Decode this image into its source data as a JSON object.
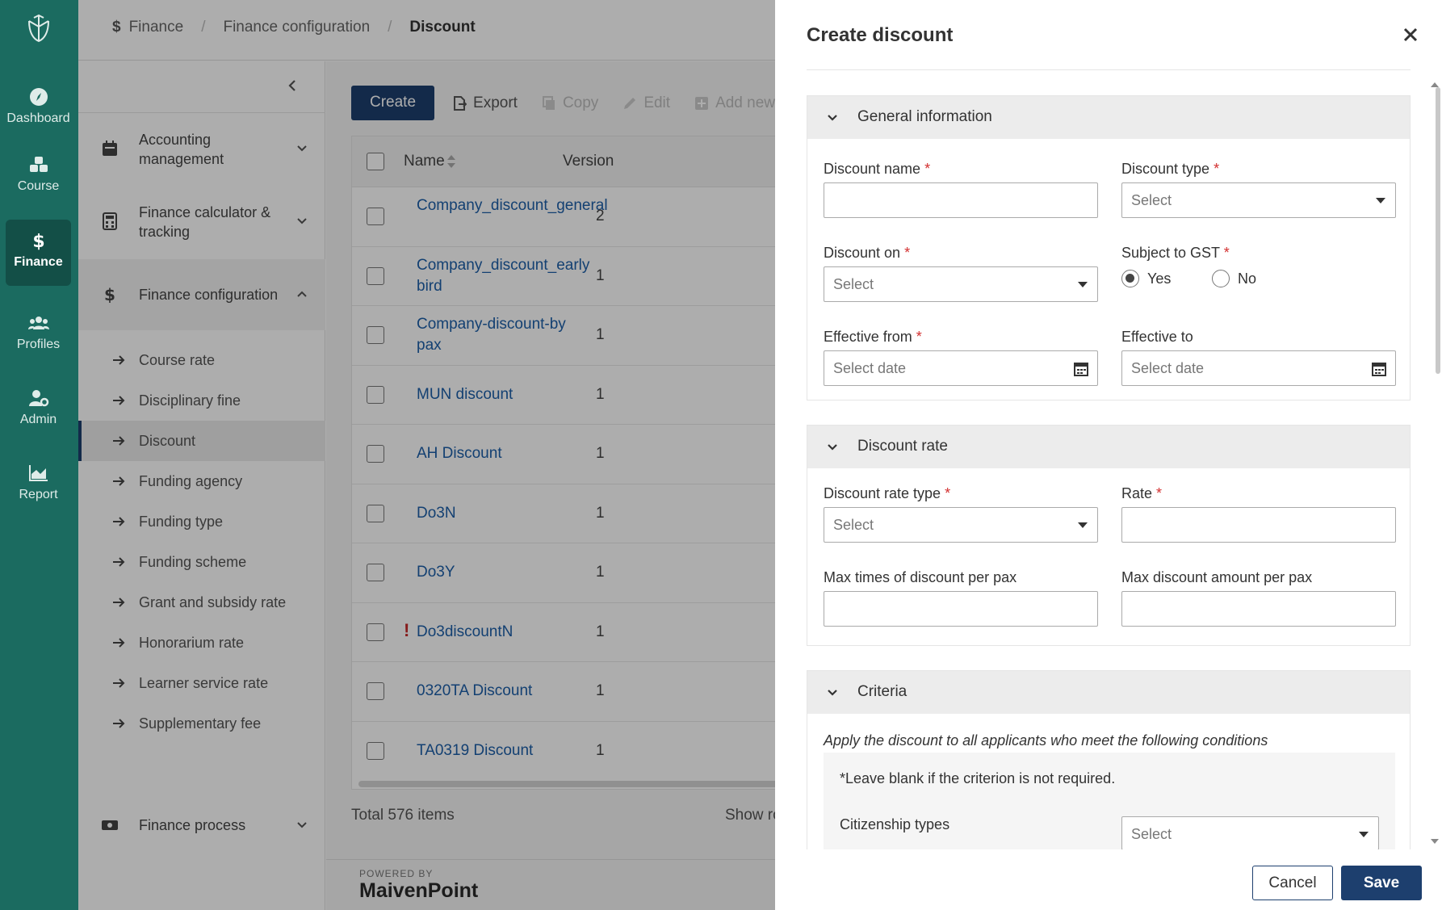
{
  "rail": {
    "items": [
      {
        "label": "Dashboard",
        "icon": "compass-icon"
      },
      {
        "label": "Course",
        "icon": "cubes-icon"
      },
      {
        "label": "Finance",
        "icon": "dollar-icon",
        "active": true
      },
      {
        "label": "Profiles",
        "icon": "users-icon"
      },
      {
        "label": "Admin",
        "icon": "user-gear-icon"
      },
      {
        "label": "Report",
        "icon": "area-chart-icon"
      }
    ]
  },
  "breadcrumb": [
    "Finance",
    "Finance configuration",
    "Discount"
  ],
  "subnav": {
    "groups": [
      {
        "label": "Accounting management",
        "icon": "calendar-icon"
      },
      {
        "label": "Finance calculator & tracking",
        "icon": "calculator-icon"
      },
      {
        "label": "Finance configuration",
        "icon": "dollar-icon"
      },
      {
        "label": "Finance process",
        "icon": "money-icon"
      }
    ],
    "items": [
      "Course rate",
      "Disciplinary fine",
      "Discount",
      "Funding agency",
      "Funding type",
      "Funding scheme",
      "Grant and subsidy rate",
      "Honorarium rate",
      "Learner service rate",
      "Supplementary fee"
    ],
    "active_item": "Discount"
  },
  "toolbar": {
    "create": "Create",
    "export": "Export",
    "copy": "Copy",
    "edit": "Edit",
    "add_new_version": "Add new ve"
  },
  "table": {
    "columns": [
      "Name",
      "Version"
    ],
    "rows": [
      {
        "name": "Company_discount_general",
        "version": "2"
      },
      {
        "name": "Company_discount_early bird",
        "version": "1"
      },
      {
        "name": "Company-discount-by pax",
        "version": "1"
      },
      {
        "name": "MUN discount",
        "version": "1"
      },
      {
        "name": "AH Discount",
        "version": "1"
      },
      {
        "name": "Do3N",
        "version": "1"
      },
      {
        "name": "Do3Y",
        "version": "1"
      },
      {
        "name": "Do3discountN",
        "version": "1",
        "warning": "!"
      },
      {
        "name": "0320TA Discount",
        "version": "1"
      },
      {
        "name": "TA0319 Discount",
        "version": "1"
      }
    ],
    "total": "Total 576 items",
    "show_rows": "Show ro"
  },
  "powered": {
    "line1": "POWERED BY",
    "line2": "MaivenPoint"
  },
  "drawer": {
    "title": "Create discount",
    "general": {
      "title": "General information",
      "discount_name": "Discount name",
      "discount_type": "Discount type",
      "discount_on": "Discount on",
      "subject_to_gst": "Subject to GST",
      "yes": "Yes",
      "no": "No",
      "effective_from": "Effective from",
      "effective_to": "Effective to",
      "select_ph": "Select",
      "date_ph": "Select date"
    },
    "rate": {
      "title": "Discount rate",
      "rate_type": "Discount rate type",
      "rate": "Rate",
      "max_times": "Max times of discount per pax",
      "max_amount": "Max discount amount per pax"
    },
    "criteria": {
      "title": "Criteria",
      "note": "Apply the discount to all applicants who meet the following conditions",
      "blank_note": "*Leave blank if the criterion is not required.",
      "citizenship": "Citizenship types"
    },
    "required_mark": "*",
    "cancel": "Cancel",
    "save": "Save"
  },
  "colors": {
    "rail": "#1b6b60",
    "primary": "#1d3f6e",
    "link": "#1d5fa8",
    "required": "#d32f2f"
  }
}
